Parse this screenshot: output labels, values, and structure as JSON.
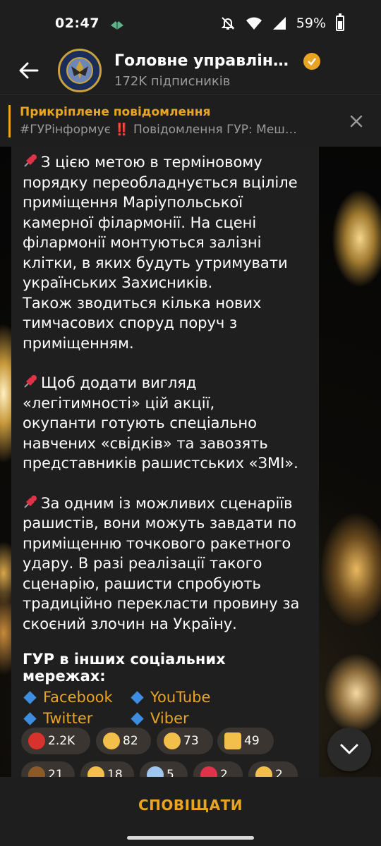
{
  "status_bar": {
    "time": "02:47",
    "battery": "59%",
    "battery_level": 0.59,
    "icons": [
      "app-notification-icon",
      "mute-icon",
      "wifi-icon",
      "signal-icon",
      "battery-icon"
    ]
  },
  "header": {
    "title": "Головне управлінн…",
    "subscribers": "172K підписників",
    "avatar_text": "РОЗВІДКА",
    "verified_color": "#e9a423"
  },
  "pinned": {
    "title": "Прикріплене повідомлення",
    "preview": "#ГУРінформує ‼️ Повідомлення ГУР: Меш…"
  },
  "message": {
    "paragraphs": [
      "З цією метою в терміновому\nпорядку переобладнується вціліле\nприміщення Маріупольської\nкамерної філармонії. На сцені\nфілармонії монтуються залізні\nклітки, в яких будуть утримувати\nукраїнських Захисників.\nТакож зводиться кілька нових\nтимчасових споруд поруч з\nприміщенням.",
      "Щоб додати вигляд\n«легітимності» цій акції,\nокупанти готують спеціально\nнавчених «свідків» та завозять\nпредставників рашистських «ЗМІ».",
      "За одним із можливих сценаріїв\nрашистів, вони можуть завдати по\nприміщенню точкового ракетного\nудару. В разі реалізації такого\nсценарію, рашисти спробують\nтрадиційно перекласти провину за\nскоєний злочин на Україну."
    ],
    "social_heading": "ГУР в інших соціальних мережах:",
    "social_links": [
      "Facebook",
      "YouTube",
      "Twitter",
      "Viber"
    ]
  },
  "reactions": [
    {
      "emoji": "cursing-face",
      "count": "2.2K"
    },
    {
      "emoji": "exploding-head",
      "count": "82"
    },
    {
      "emoji": "crying-face",
      "count": "73"
    },
    {
      "emoji": "thumbs-up",
      "count": "49"
    },
    {
      "emoji": "poop",
      "count": "21"
    },
    {
      "emoji": "folded-hands",
      "count": "18"
    },
    {
      "emoji": "screaming-face",
      "count": "5"
    },
    {
      "emoji": "red-heart",
      "count": "2"
    },
    {
      "emoji": "thinking-face",
      "count": "2"
    }
  ],
  "bottom": {
    "notify_label": "СПОВІЩАТИ"
  },
  "colors": {
    "accent": "#e9a423",
    "link_bullet": "#3d8de0",
    "bubble": "#1f1f1f",
    "bar": "#1e1e1e"
  }
}
